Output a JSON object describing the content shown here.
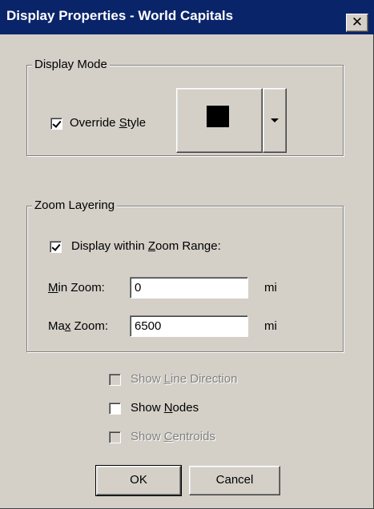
{
  "window": {
    "title": "Display Properties - World Capitals",
    "close_glyph": "✕",
    "close_icon": "close-icon"
  },
  "display_mode": {
    "group_label": "Display Mode",
    "override_style": {
      "label_pre": "Override ",
      "label_mnemonic": "S",
      "label_post": "tyle",
      "checked": true
    },
    "style_color": "#000000",
    "dropdown_icon": "chevron-down-icon"
  },
  "zoom_layering": {
    "group_label": "Zoom Layering",
    "display_within": {
      "label_pre": "Display within ",
      "label_mnemonic": "Z",
      "label_post": "oom Range:",
      "checked": true
    },
    "min_zoom": {
      "label_pre": "",
      "label_mnemonic": "M",
      "label_post": "in Zoom:",
      "value": "0",
      "unit": "mi"
    },
    "max_zoom": {
      "label_pre": "Ma",
      "label_mnemonic": "x",
      "label_post": " Zoom:",
      "value": "6500",
      "unit": "mi"
    }
  },
  "options": {
    "show_line_direction": {
      "label_pre": "Show ",
      "label_mnemonic": "L",
      "label_post": "ine Direction",
      "checked": false,
      "enabled": false
    },
    "show_nodes": {
      "label_pre": "Show ",
      "label_mnemonic": "N",
      "label_post": "odes",
      "checked": false,
      "enabled": true
    },
    "show_centroids": {
      "label_pre": "Show ",
      "label_mnemonic": "C",
      "label_post": "entroids",
      "checked": false,
      "enabled": false
    }
  },
  "buttons": {
    "ok": "OK",
    "cancel": "Cancel"
  },
  "colors": {
    "title_bar": "#0a246a",
    "dialog_face": "#d4d0c8",
    "disabled_text": "#808080"
  }
}
